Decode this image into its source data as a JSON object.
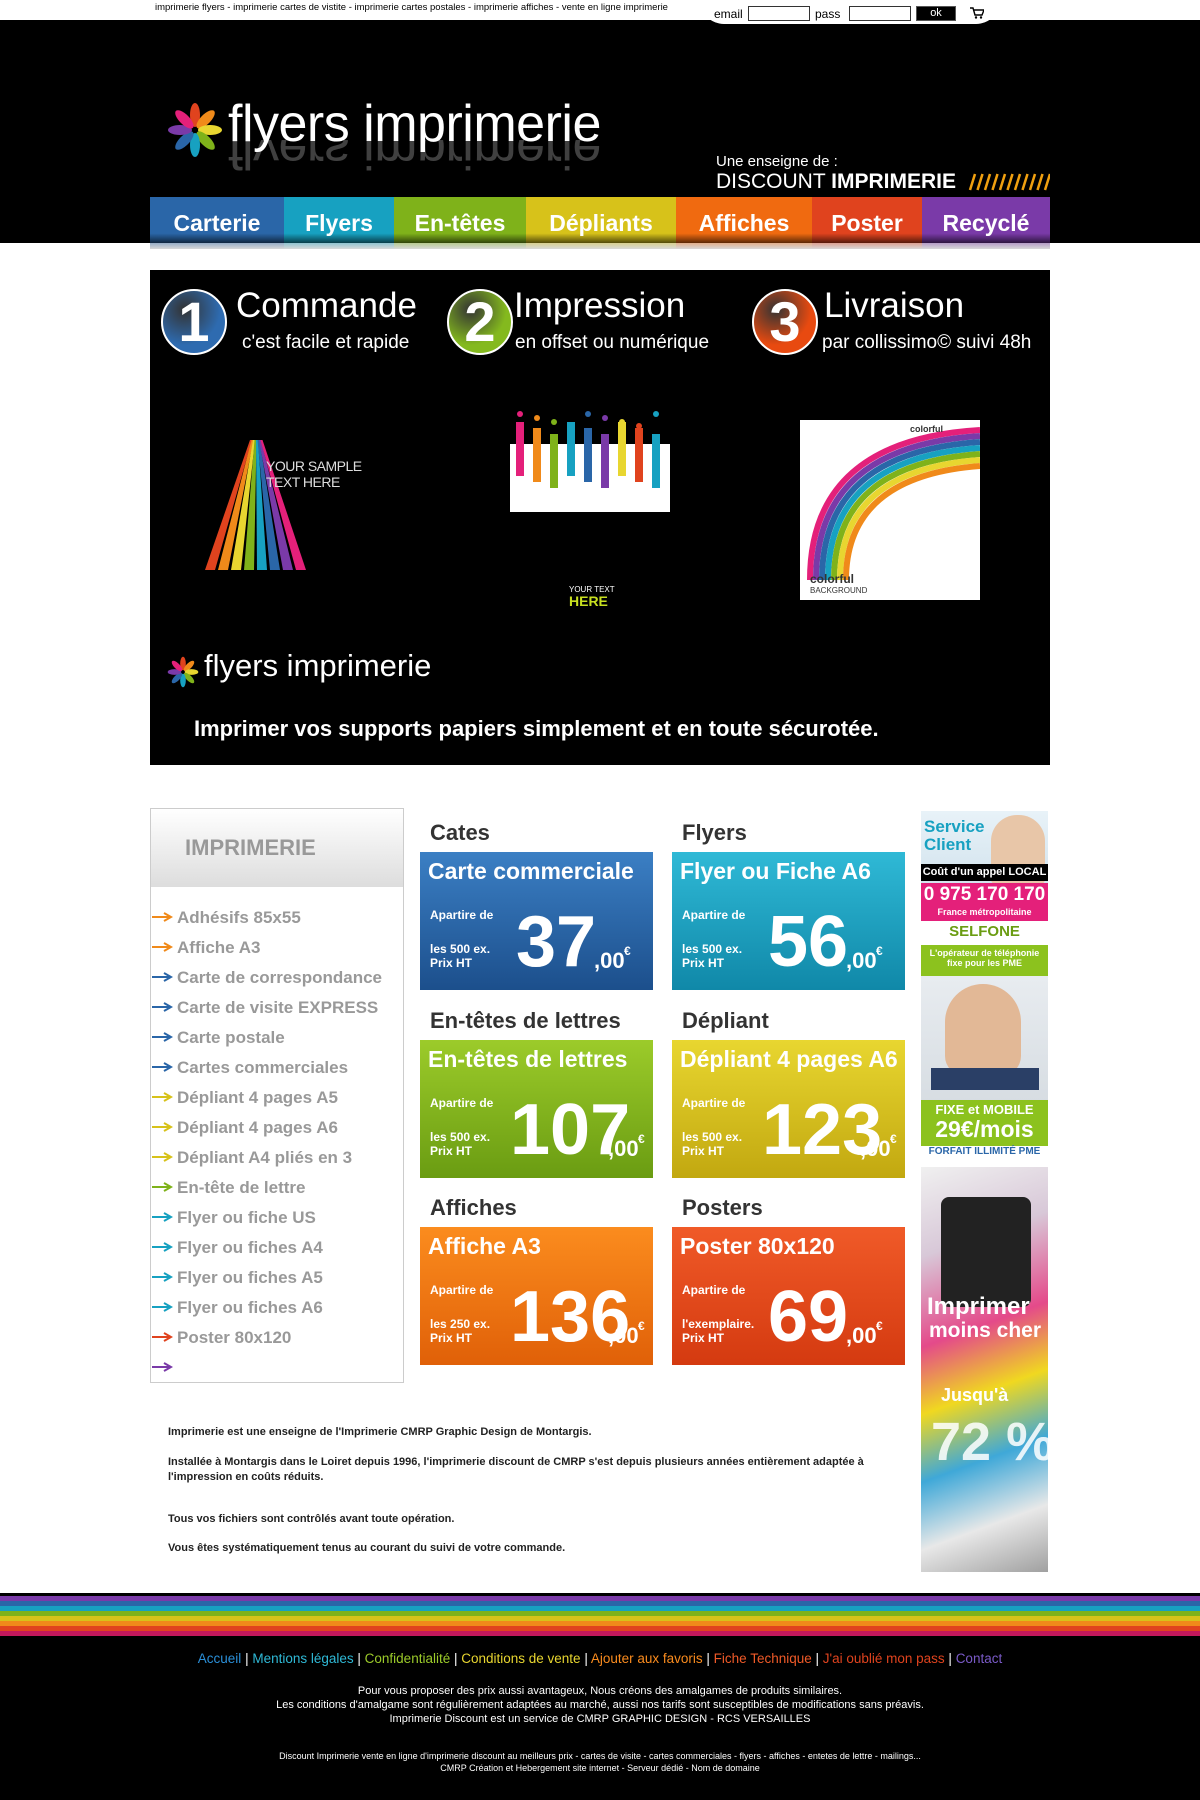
{
  "top": {
    "seo_links": "imprimerie flyers - imprimerie cartes de vistite - imprimerie cartes postales - imprimerie affiches - vente en ligne imprimerie",
    "email_label": "email",
    "pass_label": "pass",
    "ok_label": "ok"
  },
  "header": {
    "logo": "flyers imprimerie",
    "enseigne": "Une enseigne de :",
    "brand_a": "DISCOUNT",
    "brand_b": "IMPRIMERIE"
  },
  "nav": [
    {
      "label": "Carterie",
      "color": "#2a66a8"
    },
    {
      "label": "Flyers",
      "color": "#17a1c1"
    },
    {
      "label": "En-têtes",
      "color": "#7fb21a"
    },
    {
      "label": "Dépliants",
      "color": "#d7c21a"
    },
    {
      "label": "Affiches",
      "color": "#f06a10"
    },
    {
      "label": "Poster",
      "color": "#e0431e"
    },
    {
      "label": "Recyclé",
      "color": "#7a3aa8"
    }
  ],
  "hero": {
    "steps": [
      {
        "num": "1",
        "title": "Commande",
        "sub": "c'est facile et rapide",
        "color": "#2e6bb0"
      },
      {
        "num": "2",
        "title": "Impression",
        "sub": "en offset ou numérique",
        "color": "#84b91e"
      },
      {
        "num": "3",
        "title": "Livraison",
        "sub": "par collissimo© suivi 48h",
        "color": "#e84a10"
      }
    ],
    "sample1": "YOUR SAMPLE TEXT HERE",
    "sample2a": "YOUR TEXT",
    "sample2b": "HERE",
    "sample3a": "colorful",
    "sample3b": "BACKGROUND",
    "logo": "flyers imprimerie",
    "tagline": "Imprimer vos supports papiers simplement et en toute sécurotée."
  },
  "sidebar": {
    "title": "IMPRIMERIE",
    "items": [
      {
        "label": "Adhésifs 85x55",
        "color": "#f08a1a"
      },
      {
        "label": "Affiche A3",
        "color": "#f08a1a"
      },
      {
        "label": "Carte de correspondance",
        "color": "#2a66a8"
      },
      {
        "label": "Carte de visite EXPRESS",
        "color": "#2a66a8"
      },
      {
        "label": "Carte postale",
        "color": "#2a66a8"
      },
      {
        "label": "Cartes commerciales",
        "color": "#2a66a8"
      },
      {
        "label": "Dépliant 4 pages A5",
        "color": "#d7c21a"
      },
      {
        "label": "Dépliant 4 pages A6",
        "color": "#d7c21a"
      },
      {
        "label": "Dépliant A4 pliés en 3",
        "color": "#d7c21a"
      },
      {
        "label": "En-tête de lettre",
        "color": "#7fb21a"
      },
      {
        "label": "Flyer ou fiche US",
        "color": "#17a1c1"
      },
      {
        "label": "Flyer ou fiches A4",
        "color": "#17a1c1"
      },
      {
        "label": "Flyer ou fiches A5",
        "color": "#17a1c1"
      },
      {
        "label": "Flyer ou fiches A6",
        "color": "#17a1c1"
      },
      {
        "label": "Poster 80x120",
        "color": "#e0431e"
      },
      {
        "label": "",
        "color": "#7a3aa8"
      }
    ]
  },
  "products": [
    {
      "section": "Cates",
      "name": "Carte commerciale",
      "l1": "Apartire de",
      "l2": "les 500 ex.",
      "l3": "Prix HT",
      "price": "37",
      "cents": ",00",
      "euro": "€",
      "c1": "#3b7fc4",
      "c2": "#1c4f8c"
    },
    {
      "section": "Flyers",
      "name": "Flyer ou Fiche A6",
      "l1": "Apartire de",
      "l2": "les 500 ex.",
      "l3": "Prix HT",
      "price": "56",
      "cents": ",00",
      "euro": "€",
      "c1": "#2fb9d6",
      "c2": "#1088a8"
    },
    {
      "section": "En-têtes de lettres",
      "name": "En-têtes de lettres",
      "l1": "Apartire de",
      "l2": "les 500 ex.",
      "l3": "Prix HT",
      "price": "107",
      "cents": ",00",
      "euro": "€",
      "c1": "#9ccb2a",
      "c2": "#6a9c12"
    },
    {
      "section": "Dépliant",
      "name": "Dépliant 4 pages A6",
      "l1": "Apartire de",
      "l2": "les 500 ex.",
      "l3": "Prix HT",
      "price": "123",
      "cents": ",00",
      "euro": "€",
      "c1": "#e8d630",
      "c2": "#c2a810"
    },
    {
      "section": "Affiches",
      "name": "Affiche A3",
      "l1": "Apartire de",
      "l2": "les 250 ex.",
      "l3": "Prix HT",
      "price": "136",
      "cents": ",00",
      "euro": "€",
      "c1": "#fb8c1e",
      "c2": "#e06008"
    },
    {
      "section": "Posters",
      "name": "Poster 80x120",
      "l1": "Apartire de",
      "l2": "l'exemplaire.",
      "l3": "Prix HT",
      "price": "69",
      "cents": ",00",
      "euro": "€",
      "c1": "#f05a28",
      "c2": "#d43a10"
    }
  ],
  "ads": {
    "service1": "Service",
    "service2": "Client",
    "cout": "Coût d'un appel LOCAL",
    "phone": "0 975 170 170",
    "france": "France métropolitaine",
    "selfone": "SELFONE",
    "operateur1": "L'opérateur de téléphonie",
    "operateur2": "fixe pour les PME",
    "fixe": "FIXE et MOBILE",
    "price": "29€/mois",
    "forfait": "FORFAIT ILLIMITÉ PME",
    "imprimer1": "Imprimer",
    "imprimer2": "moins cher",
    "jusqua": "Jusqu'à",
    "percent": "72 %"
  },
  "about": {
    "p1": "Imprimerie est une enseigne de l'Imprimerie CMRP Graphic Design de Montargis.",
    "p2": "Installée à Montargis dans le Loiret depuis 1996, l'imprimerie discount de CMRP s'est depuis plusieurs années entièrement adaptée à l'impression en coûts réduits.",
    "p3": "Tous vos fichiers sont contrôlés avant toute opération.",
    "p4": "Vous êtes systématiquement tenus au courant du suivi de votre commande."
  },
  "rainbow": [
    "#7a3aa8",
    "#2a66a8",
    "#17a1c1",
    "#7fb21a",
    "#d7c21a",
    "#f08a1a",
    "#e0431e",
    "#c2185b"
  ],
  "footer": {
    "links": [
      {
        "label": "Accueil",
        "color": "#2a8fd8"
      },
      {
        "label": "Mentions légales",
        "color": "#2fb9d6"
      },
      {
        "label": "Confidentialité",
        "color": "#9ccb2a"
      },
      {
        "label": "Conditions de vente",
        "color": "#e8d630"
      },
      {
        "label": "Ajouter aux favoris",
        "color": "#fb8c1e"
      },
      {
        "label": "Fiche Technique",
        "color": "#f05a28"
      },
      {
        "label": "J'ai oublié mon pass",
        "color": "#e0431e"
      },
      {
        "label": "Contact",
        "color": "#7a5ac8"
      }
    ],
    "t1": "Pour vous proposer des prix aussi avantageux, Nous créons des amalgames de produits similaires.",
    "t2": "Les conditions d'amalgame sont régulièrement adaptées au marché, aussi nos tarifs sont susceptibles de modifications sans préavis.",
    "t3": "Imprimerie Discount est un service de CMRP GRAPHIC DESIGN - RCS VERSAILLES",
    "t4": "Discount Imprimerie vente en ligne d'imprimerie discount au meilleurs prix - cartes de visite - cartes commerciales - flyers - affiches - entetes de lettre - mailings...",
    "t5": "CMRP Création et Hebergement site internet - Serveur dédié - Nom de domaine"
  }
}
